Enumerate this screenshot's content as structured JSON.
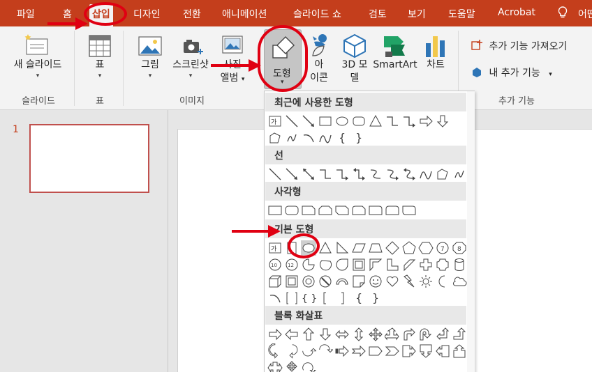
{
  "menu": {
    "tabs": [
      {
        "label": "파일"
      },
      {
        "label": "홈"
      },
      {
        "label": "삽입"
      },
      {
        "label": "디자인"
      },
      {
        "label": "전환"
      },
      {
        "label": "애니메이션"
      },
      {
        "label": "슬라이드 쇼"
      },
      {
        "label": "검토"
      },
      {
        "label": "보기"
      },
      {
        "label": "도움말"
      },
      {
        "label": "Acrobat"
      }
    ],
    "help_search": "어떤"
  },
  "ribbon": {
    "new_slide_line1": "새 슬라이드",
    "table": "표",
    "pictures": "그림",
    "screenshot": "스크린샷",
    "album_line1": "사진",
    "album_line2": "앨범",
    "shapes": "도형",
    "icons_line1": "아",
    "icons_line2": "이콘",
    "model3d_line1": "3D 모",
    "model3d_line2": "델",
    "smartart": "SmartArt",
    "chart": "차트",
    "get_addins": "추가 기능 가져오기",
    "my_addins": "내 추가 기능",
    "groups": {
      "slides": "슬라이드",
      "table": "표",
      "images": "이미지",
      "addins": "추가 기능"
    }
  },
  "slides_pane": {
    "slide_number": "1"
  },
  "shapes_gallery": {
    "sections": [
      {
        "title": "최근에 사용한 도형"
      },
      {
        "title": "선"
      },
      {
        "title": "사각형"
      },
      {
        "title": "기본 도형"
      },
      {
        "title": "블록 화살표"
      }
    ],
    "textbox_glyph": "가"
  },
  "colors": {
    "accent": "#c43e1c",
    "ribbon_bg": "#f3f3f3",
    "annotation_red": "#e00012"
  }
}
